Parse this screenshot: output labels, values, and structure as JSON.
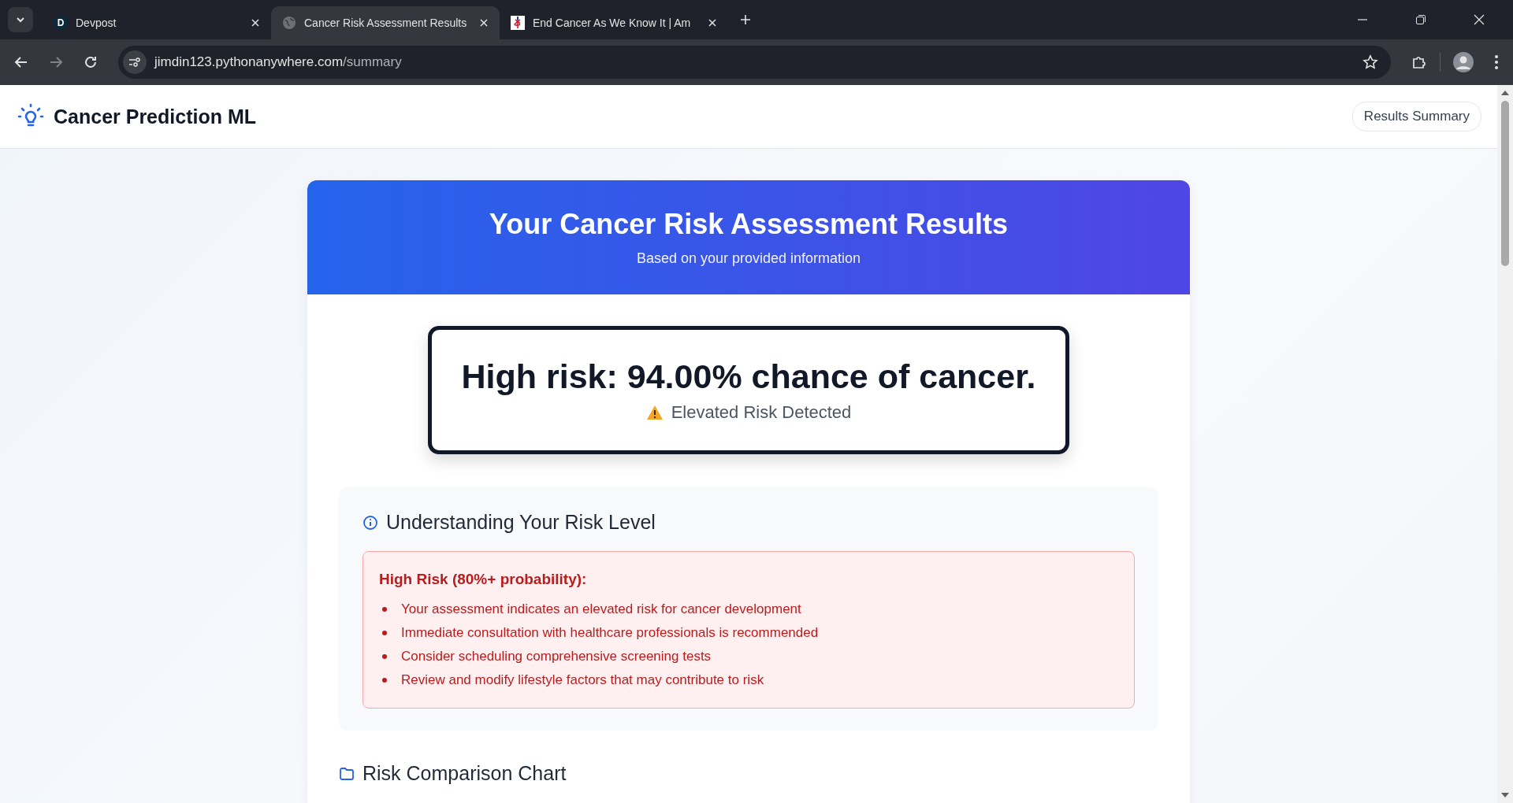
{
  "browser": {
    "tabs": [
      {
        "title": "Devpost",
        "favicon_letter": "D",
        "selected": false
      },
      {
        "title": "Cancer Risk Assessment Results",
        "selected": true
      },
      {
        "title": "End Cancer As We Know It | Am",
        "selected": false
      }
    ],
    "url_host": "jimdin123.pythonanywhere.com",
    "url_path": "/summary"
  },
  "navbar": {
    "brand": "Cancer Prediction ML",
    "button": "Results Summary"
  },
  "banner": {
    "title": "Your Cancer Risk Assessment Results",
    "subtitle": "Based on your provided information"
  },
  "result": {
    "headline": "High risk: 94.00% chance of cancer.",
    "status": "Elevated Risk Detected"
  },
  "risk_level": {
    "title": "Understanding Your Risk Level",
    "heading": "High Risk (80%+ probability):",
    "points": [
      "Your assessment indicates an elevated risk for cancer development",
      "Immediate consultation with healthcare professionals is recommended",
      "Consider scheduling comprehensive screening tests",
      "Review and modify lifestyle factors that may contribute to risk"
    ]
  },
  "chart_section": {
    "title": "Risk Comparison Chart"
  }
}
